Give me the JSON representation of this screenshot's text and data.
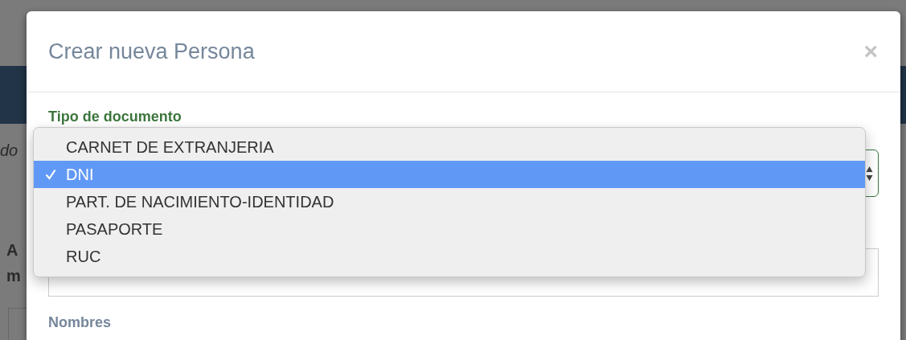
{
  "background_page": {
    "fragments": [
      "do",
      "A",
      "m"
    ]
  },
  "modal": {
    "title": "Crear nueva Persona",
    "close": "×",
    "document_type": {
      "label": "Tipo de documento"
    },
    "names": {
      "label": "Nombres"
    }
  },
  "dropdown": {
    "options": [
      {
        "label": "CARNET DE EXTRANJERIA",
        "selected": false
      },
      {
        "label": "DNI",
        "selected": true
      },
      {
        "label": "PART. DE NACIMIENTO-IDENTIDAD",
        "selected": false
      },
      {
        "label": "PASAPORTE",
        "selected": false
      },
      {
        "label": "RUC",
        "selected": false
      }
    ]
  }
}
